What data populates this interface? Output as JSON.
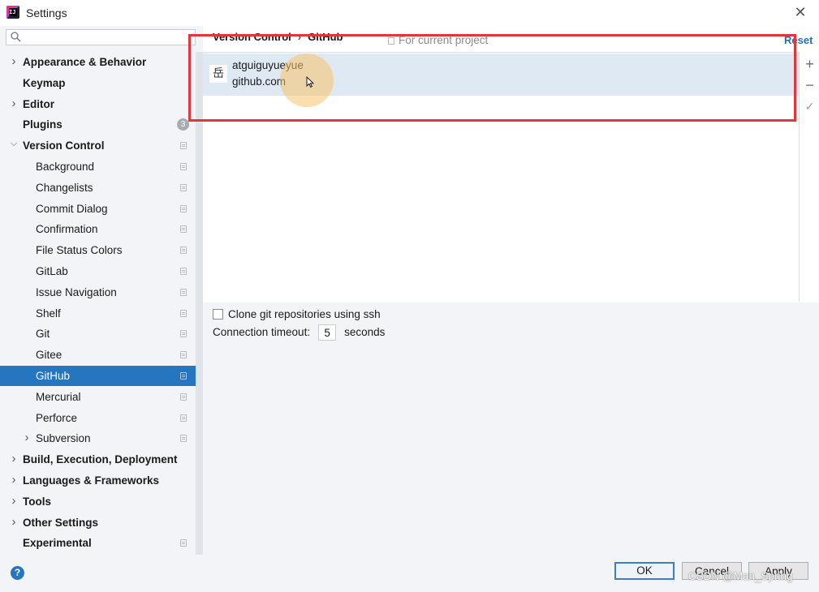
{
  "window": {
    "title": "Settings",
    "close_icon": "close-icon"
  },
  "sidebar": {
    "search_placeholder": "",
    "items": [
      {
        "label": "Appearance & Behavior",
        "bold": true,
        "expandable": true,
        "expanded": false,
        "level": 0
      },
      {
        "label": "Keymap",
        "bold": true,
        "expandable": false,
        "level": 0
      },
      {
        "label": "Editor",
        "bold": true,
        "expandable": true,
        "expanded": false,
        "level": 0
      },
      {
        "label": "Plugins",
        "bold": true,
        "expandable": false,
        "level": 0,
        "badge": "3"
      },
      {
        "label": "Version Control",
        "bold": true,
        "expandable": true,
        "expanded": true,
        "level": 0,
        "project_icon": true
      },
      {
        "label": "Background",
        "level": 1,
        "project_icon": true
      },
      {
        "label": "Changelists",
        "level": 1,
        "project_icon": true
      },
      {
        "label": "Commit Dialog",
        "level": 1,
        "project_icon": true
      },
      {
        "label": "Confirmation",
        "level": 1,
        "project_icon": true
      },
      {
        "label": "File Status Colors",
        "level": 1,
        "project_icon": true
      },
      {
        "label": "GitLab",
        "level": 1,
        "project_icon": true
      },
      {
        "label": "Issue Navigation",
        "level": 1,
        "project_icon": true
      },
      {
        "label": "Shelf",
        "level": 1,
        "project_icon": true
      },
      {
        "label": "Git",
        "level": 1,
        "project_icon": true
      },
      {
        "label": "Gitee",
        "level": 1,
        "project_icon": true
      },
      {
        "label": "GitHub",
        "level": 1,
        "project_icon": true,
        "selected": true
      },
      {
        "label": "Mercurial",
        "level": 1,
        "project_icon": true
      },
      {
        "label": "Perforce",
        "level": 1,
        "project_icon": true
      },
      {
        "label": "Subversion",
        "level": 1,
        "expandable": true,
        "expanded": false,
        "project_icon": true
      },
      {
        "label": "Build, Execution, Deployment",
        "bold": true,
        "expandable": true,
        "expanded": false,
        "level": 0
      },
      {
        "label": "Languages & Frameworks",
        "bold": true,
        "expandable": true,
        "expanded": false,
        "level": 0
      },
      {
        "label": "Tools",
        "bold": true,
        "expandable": true,
        "expanded": false,
        "level": 0
      },
      {
        "label": "Other Settings",
        "bold": true,
        "expandable": true,
        "expanded": false,
        "level": 0
      },
      {
        "label": "Experimental",
        "bold": true,
        "expandable": false,
        "level": 0,
        "project_icon": true
      }
    ]
  },
  "breadcrumb": {
    "parent": "Version Control",
    "separator": "›",
    "current": "GitHub"
  },
  "scope_label": "For current project",
  "reset_label": "Reset",
  "accounts": [
    {
      "avatar": "岳",
      "name": "atguiguyueyue",
      "host": "github.com"
    }
  ],
  "account_toolbar": {
    "add": "+",
    "remove": "−",
    "default": "✓"
  },
  "options": {
    "clone_ssh_label": "Clone git repositories using ssh",
    "clone_ssh_checked": false,
    "timeout_label": "Connection timeout:",
    "timeout_value": "5",
    "timeout_unit": "seconds"
  },
  "footer": {
    "help": "?",
    "ok": "OK",
    "cancel": "Cancel",
    "apply": "Apply",
    "watermark": "CSDN @Man_Spring"
  },
  "colors": {
    "selection": "#2675bf",
    "annotation_box": "#e2363d",
    "link": "#2470b3"
  }
}
